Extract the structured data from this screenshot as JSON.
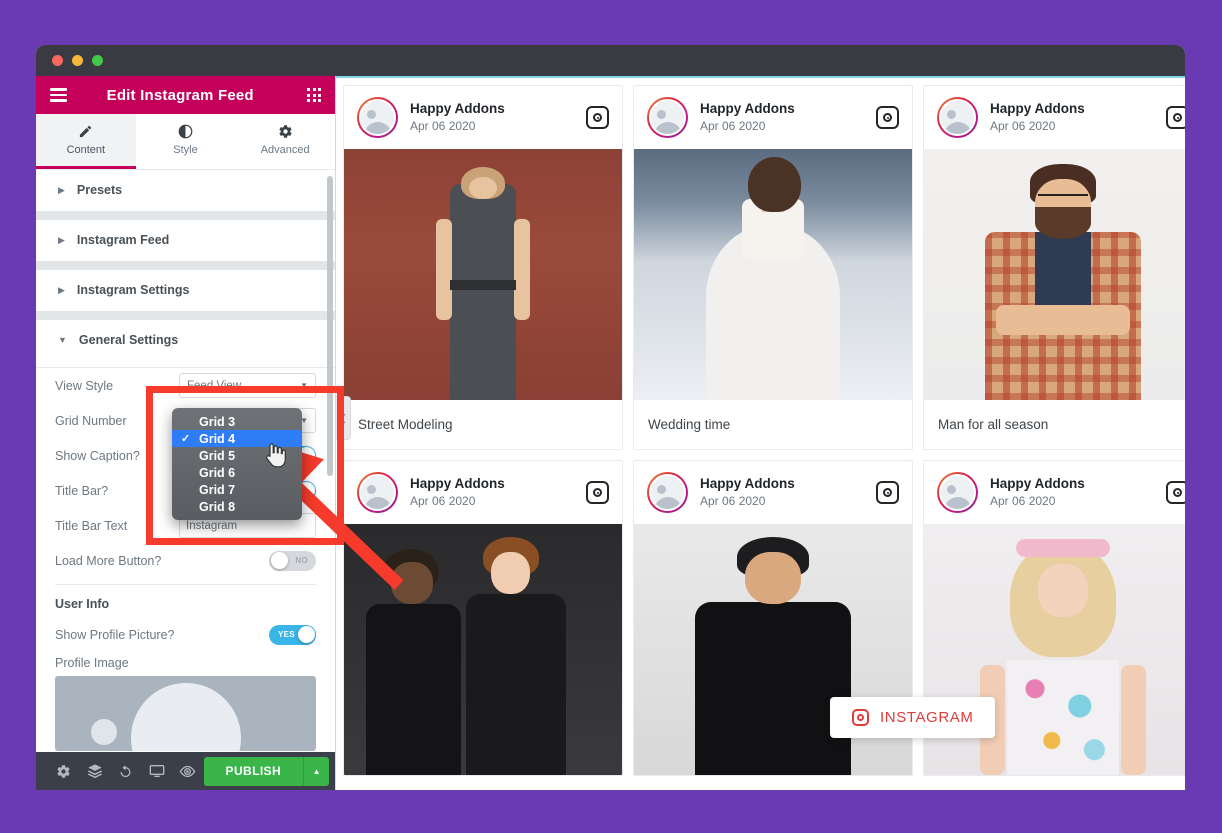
{
  "window": {
    "traffic_lights": [
      "close",
      "minimize",
      "maximize"
    ]
  },
  "panel": {
    "title": "Edit Instagram Feed",
    "menu_icon": "hamburger-icon",
    "apps_icon": "grid-dots-icon",
    "tabs": [
      {
        "label": "Content",
        "icon": "pencil-icon",
        "active": true
      },
      {
        "label": "Style",
        "icon": "contrast-icon",
        "active": false
      },
      {
        "label": "Advanced",
        "icon": "gear-icon",
        "active": false
      }
    ],
    "sections": [
      {
        "label": "Presets",
        "expanded": false
      },
      {
        "label": "Instagram Feed",
        "expanded": false
      },
      {
        "label": "Instagram Settings",
        "expanded": false
      },
      {
        "label": "General Settings",
        "expanded": true
      }
    ],
    "controls": [
      {
        "label": "View Style",
        "type": "select",
        "value": "Feed View"
      },
      {
        "label": "Grid Number",
        "type": "select",
        "value": ""
      },
      {
        "label": "Show Caption?",
        "type": "switch",
        "value": "YES",
        "on": true
      },
      {
        "label": "Title Bar?",
        "type": "switch",
        "value": "YES",
        "on": true
      },
      {
        "label": "Title Bar Text",
        "type": "text",
        "value": "Instagram"
      },
      {
        "label": "Load More Button?",
        "type": "switch",
        "value": "NO",
        "on": false
      }
    ],
    "user_info": {
      "heading": "User Info",
      "show_profile_label": "Show Profile Picture?",
      "show_profile_value": "YES",
      "profile_image_label": "Profile Image"
    },
    "footer": {
      "icons": [
        "gear-icon",
        "layers-icon",
        "history-icon",
        "responsive-icon",
        "preview-icon"
      ],
      "publish_label": "PUBLISH",
      "publish_arrow_icon": "chevron-up-icon"
    }
  },
  "dropdown": {
    "options": [
      "Grid 3",
      "Grid 4",
      "Grid 5",
      "Grid 6",
      "Grid 7",
      "Grid 8"
    ],
    "selected": "Grid 4",
    "check_glyph": "✓"
  },
  "canvas": {
    "collapse_icon": "chevron-left-icon",
    "instagram_button": {
      "label": "INSTAGRAM",
      "icon": "instagram-icon",
      "color": "#e23b3b"
    },
    "cards": [
      {
        "user": "Happy Addons",
        "date": "Apr 06 2020",
        "caption": "Street Modeling",
        "badge_icon": "instagram-icon",
        "art": "img-street"
      },
      {
        "user": "Happy Addons",
        "date": "Apr 06 2020",
        "caption": "Wedding time",
        "badge_icon": "instagram-icon",
        "art": "img-wedding"
      },
      {
        "user": "Happy Addons",
        "date": "Apr 06 2020",
        "caption": "Man for all season",
        "badge_icon": "instagram-icon",
        "art": "img-man"
      },
      {
        "user": "Happy Addons",
        "date": "Apr 06 2020",
        "caption": "",
        "badge_icon": "instagram-icon",
        "art": "img-two"
      },
      {
        "user": "Happy Addons",
        "date": "Apr 06 2020",
        "caption": "",
        "badge_icon": "instagram-icon",
        "art": "img-model"
      },
      {
        "user": "Happy Addons",
        "date": "Apr 06 2020",
        "caption": "",
        "badge_icon": "instagram-icon",
        "art": "img-pink"
      }
    ]
  },
  "colors": {
    "brand_magenta": "#c4005b",
    "publish_green": "#39b54a",
    "toggle_blue": "#39b5e8",
    "annotation_red": "#f63a2b",
    "highlight_blue": "#2f7df6",
    "page_purple": "#6a3ab2"
  }
}
